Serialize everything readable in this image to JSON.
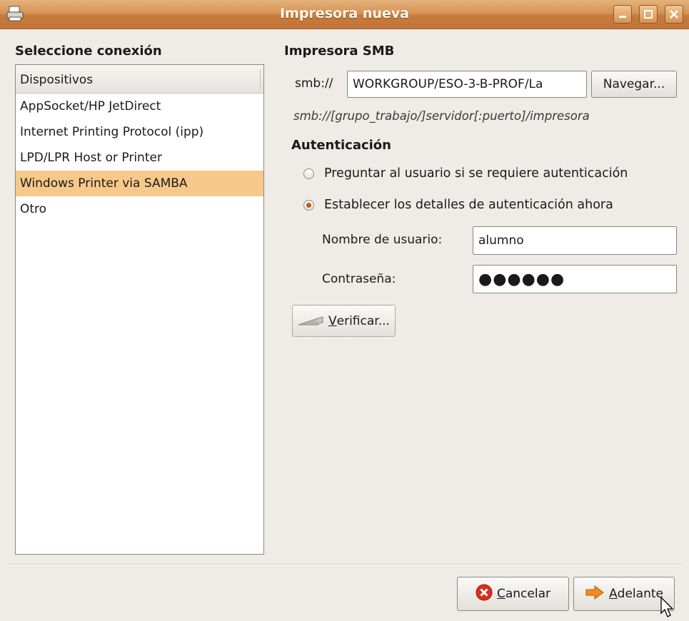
{
  "window": {
    "title": "Impresora nueva"
  },
  "left": {
    "heading": "Seleccione conexión",
    "list_header": "Dispositivos",
    "items": [
      {
        "label": "AppSocket/HP JetDirect"
      },
      {
        "label": "Internet Printing Protocol (ipp)"
      },
      {
        "label": "LPD/LPR Host or Printer"
      },
      {
        "label": "Windows Printer via SAMBA",
        "selected": true
      },
      {
        "label": "Otro"
      }
    ]
  },
  "right": {
    "heading": "Impresora SMB",
    "uri_prefix": "smb://",
    "uri_value": "WORKGROUP/ESO-3-B-PROF/La",
    "browse_label": "Navegar...",
    "hint": "smb://[grupo_trabajo/]servidor[:puerto]/impresora",
    "auth_heading": "Autenticación",
    "radio_ask": "Preguntar al usuario si se requiere autenticación",
    "radio_now": "Establecer los detalles de autenticación ahora",
    "radio_selected": "now",
    "user_label": "Nombre de usuario:",
    "user_value": "alumno",
    "pass_label": "Contraseña:",
    "pass_value": "●●●●●●",
    "verify_label_u": "V",
    "verify_label_rest": "erificar..."
  },
  "footer": {
    "cancel_u": "C",
    "cancel_rest": "ancelar",
    "next_u": "A",
    "next_rest": "delante"
  },
  "colors": {
    "titlebar": "#d69457",
    "selection": "#f6c98b",
    "window_bg": "#efebe7"
  }
}
